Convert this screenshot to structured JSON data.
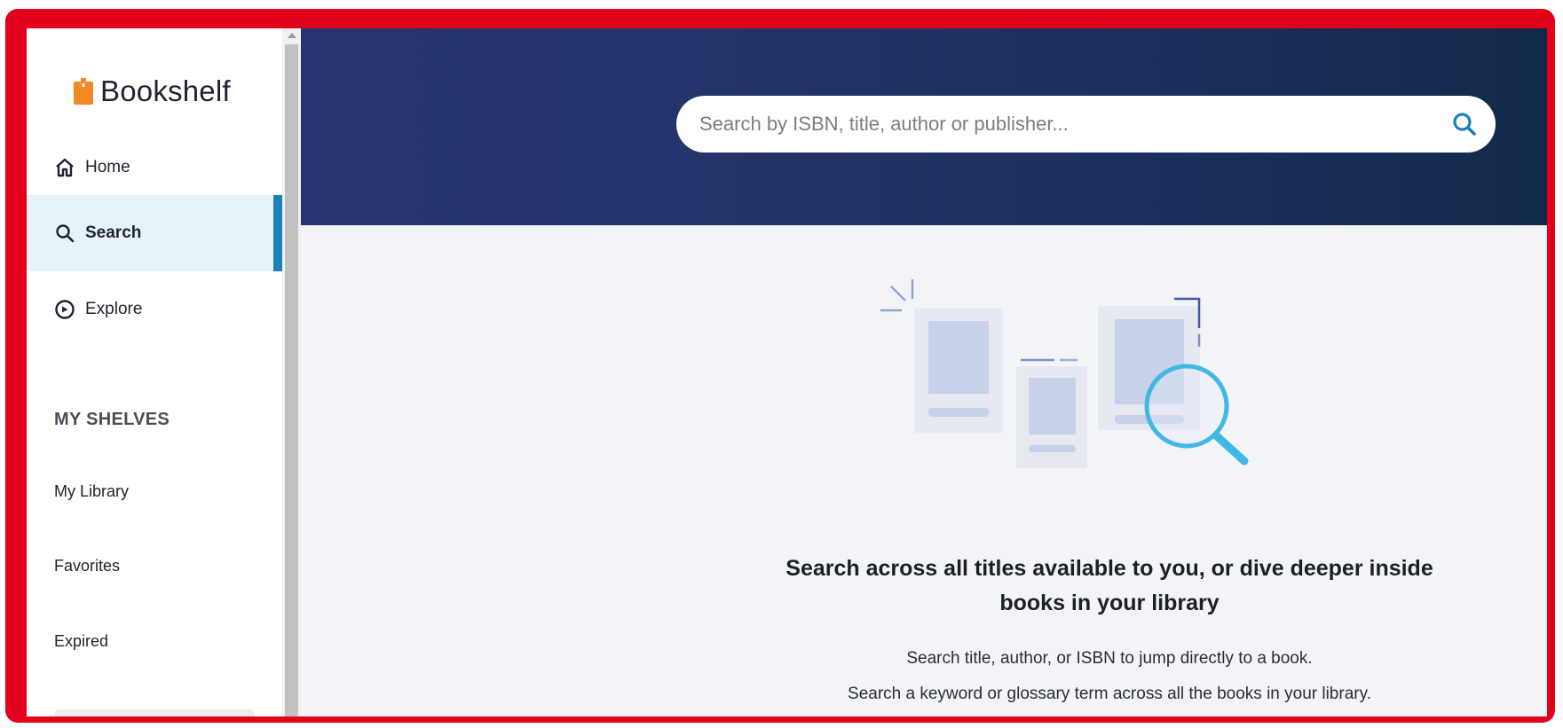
{
  "app": {
    "logo_text": "Bookshelf"
  },
  "sidebar": {
    "nav": [
      {
        "label": "Home",
        "icon": "home-icon"
      },
      {
        "label": "Search",
        "icon": "search-icon",
        "active": true
      },
      {
        "label": "Explore",
        "icon": "compass-icon"
      }
    ],
    "section_title": "MY SHELVES",
    "shelves": [
      {
        "label": "My Library"
      },
      {
        "label": "Favorites"
      },
      {
        "label": "Expired"
      }
    ]
  },
  "search": {
    "placeholder": "Search by ISBN, title, author or publisher..."
  },
  "empty_state": {
    "headline": "Search across all titles available to you, or dive deeper inside books in your library",
    "line1": "Search title, author, or ISBN to jump directly to a book.",
    "line2": "Search a keyword or glossary term across all the books in your library."
  },
  "colors": {
    "frame": "#e3001b",
    "header_start": "#263571",
    "header_end": "#122a4a",
    "accent": "#1d80b8",
    "logo": "#f08a24",
    "magnifier": "#3fb8e3"
  }
}
